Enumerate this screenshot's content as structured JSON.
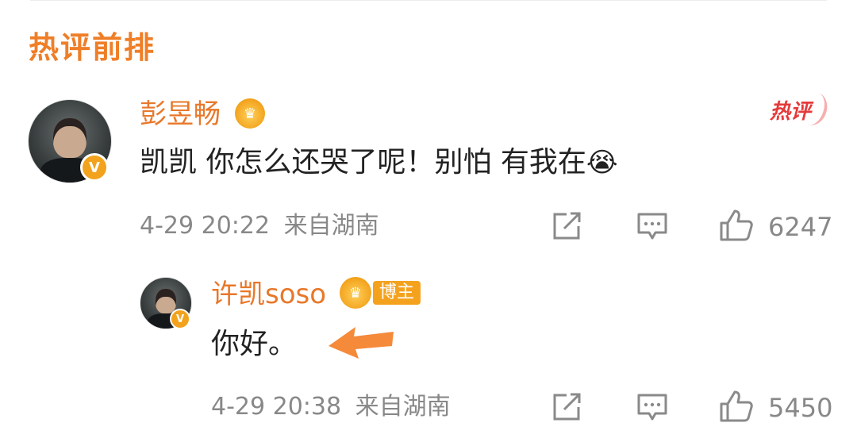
{
  "section": {
    "title": "热评前排"
  },
  "comment": {
    "username": "彭昱畅",
    "text": "凯凯 你怎么还哭了呢！别怕 有我在",
    "emoji": "😭",
    "hot_tag": "热评",
    "timestamp": "4-29 20:22",
    "location": "来自湖南",
    "likes": "6247",
    "verified_mark": "V"
  },
  "reply": {
    "username": "许凯soso",
    "badge": "博主",
    "text": "你好。",
    "timestamp": "4-29 20:38",
    "location": "来自湖南",
    "likes": "5450",
    "verified_mark": "V"
  },
  "colors": {
    "accent": "#ef7e27",
    "username": "#e8782a",
    "hot": "#e53a3a",
    "meta": "#888888"
  },
  "icons": [
    "share-icon",
    "comment-icon",
    "like-icon",
    "crown-icon",
    "arrow-icon"
  ]
}
